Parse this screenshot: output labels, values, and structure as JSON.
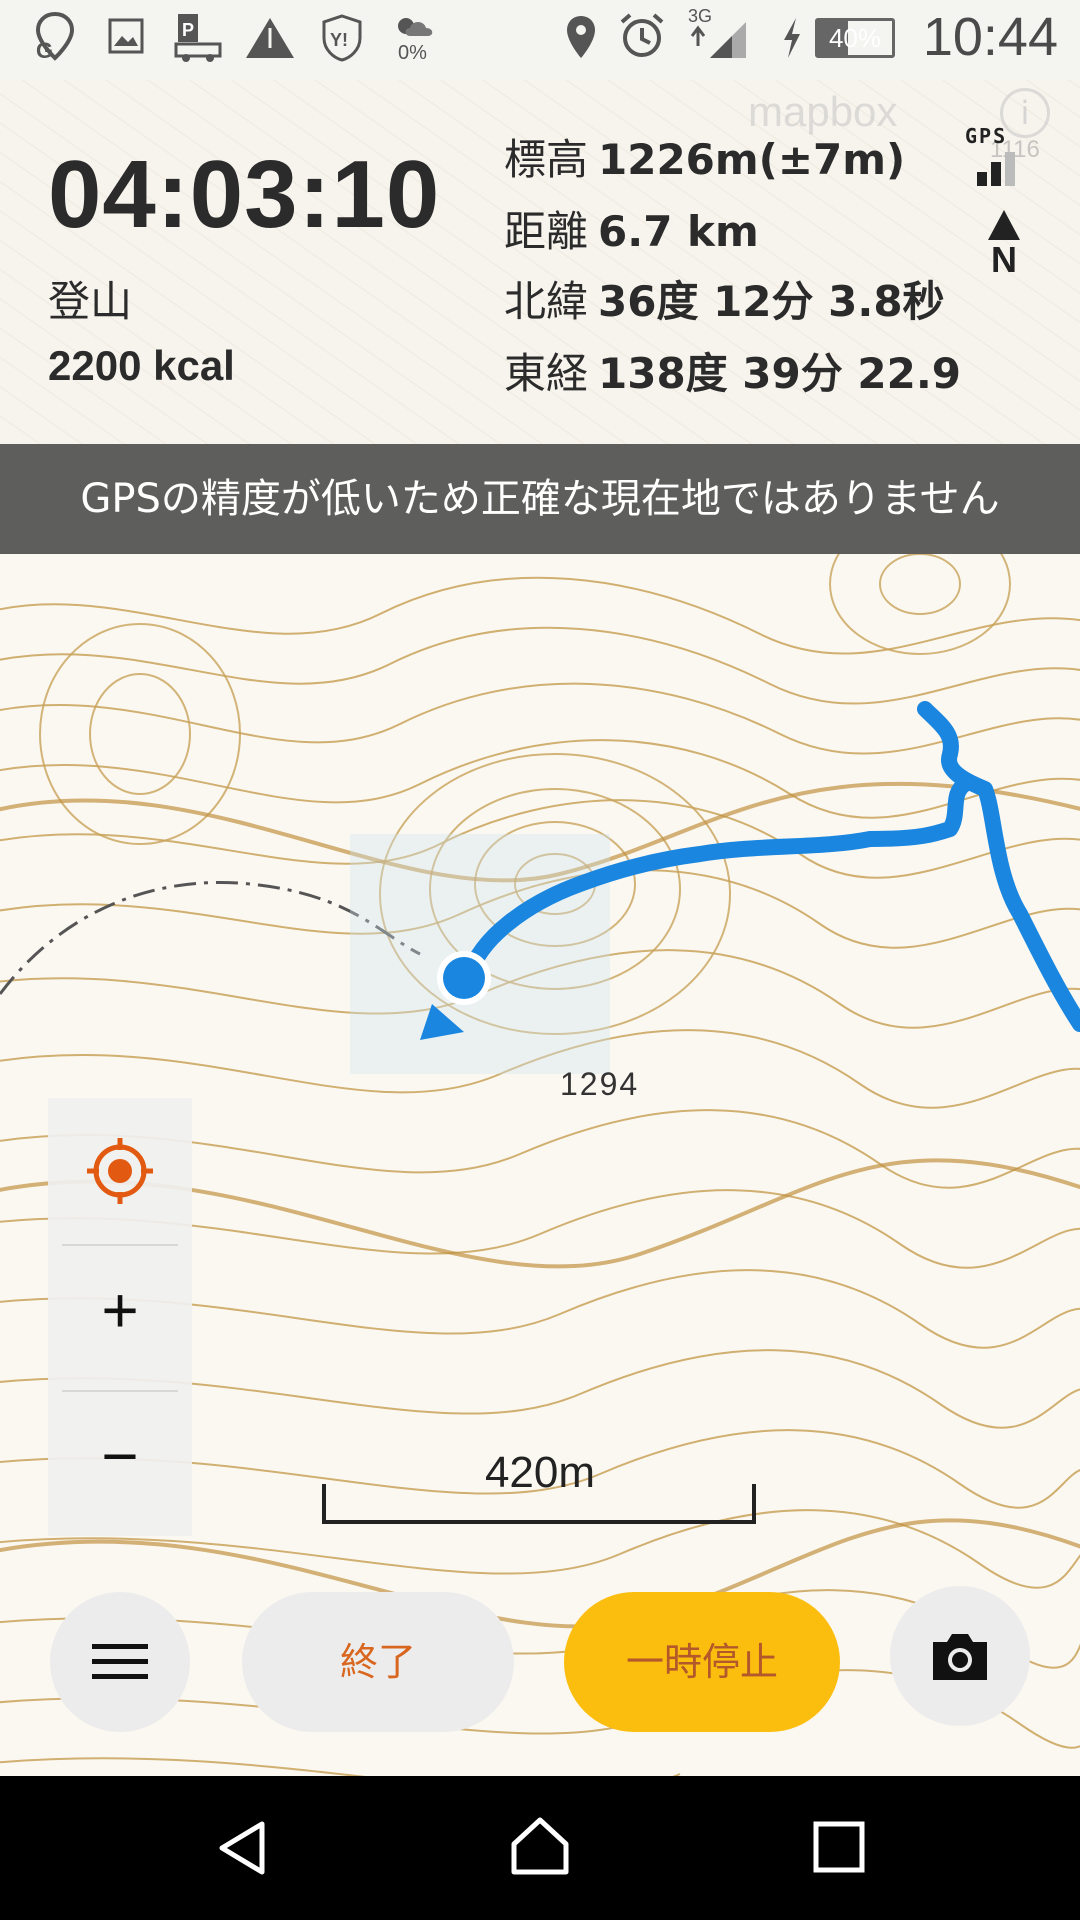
{
  "status_bar": {
    "icons": [
      "g-maps-icon",
      "image-icon",
      "parking-icon",
      "warning-icon",
      "yahoo-shield-icon",
      "weather-icon",
      "location-icon",
      "alarm-icon",
      "signal-icon",
      "charging-icon",
      "battery-icon"
    ],
    "weather_percent": "0%",
    "network": "3G",
    "battery_percent": "40%",
    "battery_level": 0.4,
    "time": "10:44"
  },
  "info": {
    "elapsed": "04:03:10",
    "activity": "登山",
    "calories": "2200 kcal",
    "stats": [
      {
        "label": "標高",
        "value": "1226m(±7m)"
      },
      {
        "label": "距離",
        "value": "6.7 km"
      },
      {
        "label": "北緯",
        "value": "36度 12分 3.8秒"
      },
      {
        "label": "東経",
        "value": "138度 39分 22.9"
      }
    ],
    "gps_label": "GPS",
    "compass_label": "N"
  },
  "map_overlay": {
    "brand": "mapbox",
    "info": "i",
    "peak_elevation": "1294",
    "faint_elevation": "1116"
  },
  "banner": {
    "text": "GPSの精度が低いため正確な現在地ではありません"
  },
  "controls": {
    "zoom_in": "+",
    "zoom_out": "−"
  },
  "scale": {
    "label": "420m"
  },
  "actions": {
    "end_label": "終了",
    "pause_label": "一時停止"
  },
  "colors": {
    "track": "#1a86e0",
    "accent_orange": "#e25a12",
    "pause_yellow": "#fbbd0e",
    "contour": "#c9a35a"
  }
}
